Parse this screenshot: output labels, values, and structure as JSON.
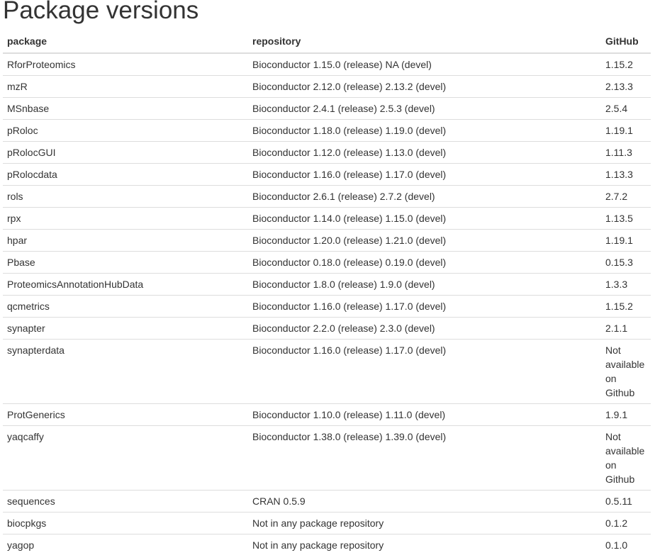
{
  "page": {
    "title": "Package versions"
  },
  "table": {
    "headers": [
      "package",
      "repository",
      "GitHub"
    ],
    "rows": [
      [
        "RforProteomics",
        "Bioconductor 1.15.0 (release) NA (devel)",
        "1.15.2"
      ],
      [
        "mzR",
        "Bioconductor 2.12.0 (release) 2.13.2 (devel)",
        "2.13.3"
      ],
      [
        "MSnbase",
        "Bioconductor 2.4.1 (release) 2.5.3 (devel)",
        "2.5.4"
      ],
      [
        "pRoloc",
        "Bioconductor 1.18.0 (release) 1.19.0 (devel)",
        "1.19.1"
      ],
      [
        "pRolocGUI",
        "Bioconductor 1.12.0 (release) 1.13.0 (devel)",
        "1.11.3"
      ],
      [
        "pRolocdata",
        "Bioconductor 1.16.0 (release) 1.17.0 (devel)",
        "1.13.3"
      ],
      [
        "rols",
        "Bioconductor 2.6.1 (release) 2.7.2 (devel)",
        "2.7.2"
      ],
      [
        "rpx",
        "Bioconductor 1.14.0 (release) 1.15.0 (devel)",
        "1.13.5"
      ],
      [
        "hpar",
        "Bioconductor 1.20.0 (release) 1.21.0 (devel)",
        "1.19.1"
      ],
      [
        "Pbase",
        "Bioconductor 0.18.0 (release) 0.19.0 (devel)",
        "0.15.3"
      ],
      [
        "ProteomicsAnnotationHubData",
        "Bioconductor 1.8.0 (release) 1.9.0 (devel)",
        "1.3.3"
      ],
      [
        "qcmetrics",
        "Bioconductor 1.16.0 (release) 1.17.0 (devel)",
        "1.15.2"
      ],
      [
        "synapter",
        "Bioconductor 2.2.0 (release) 2.3.0 (devel)",
        "2.1.1"
      ],
      [
        "synapterdata",
        "Bioconductor 1.16.0 (release) 1.17.0 (devel)",
        "Not available on Github"
      ],
      [
        "ProtGenerics",
        "Bioconductor 1.10.0 (release) 1.11.0 (devel)",
        "1.9.1"
      ],
      [
        "yaqcaffy",
        "Bioconductor 1.38.0 (release) 1.39.0 (devel)",
        "Not available on Github"
      ],
      [
        "sequences",
        "CRAN 0.5.9",
        "0.5.11"
      ],
      [
        "biocpkgs",
        "Not in any package repository",
        "0.1.2"
      ],
      [
        "yagop",
        "Not in any package repository",
        "0.1.0"
      ]
    ]
  }
}
